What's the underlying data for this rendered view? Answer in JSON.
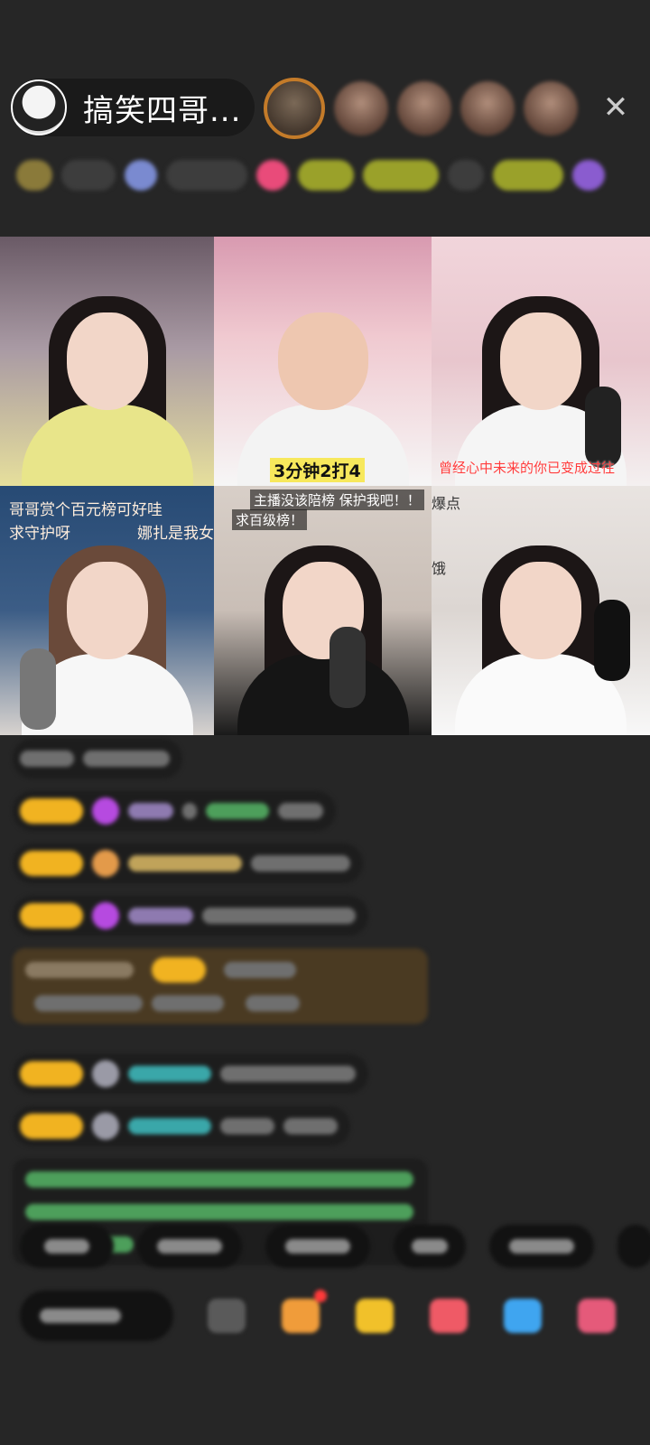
{
  "header": {
    "host_name": "搞笑四哥...",
    "close_glyph": "✕"
  },
  "video_grid": {
    "tile2_score": "3分钟2打4",
    "tile3_caption": "曾经心中未来的你已变成过往",
    "tile4_line1": "哥哥赏个百元榜可好哇",
    "tile4_line2": "求守护呀",
    "tile4_line3": "娜扎是我女",
    "tile5_line1": "主播没该陪榜 保护我吧！！",
    "tile5_line2": "求百级榜！",
    "tile6_line1": "爆点",
    "tile6_line2": "饿"
  },
  "colors": {
    "background": "#262626",
    "badge": "#f1b321",
    "score_bg": "#f7e85c",
    "caption_red": "#ff3b3b"
  },
  "icons": {
    "close": "close-icon",
    "emoji": "emoji-icon",
    "gift": "gift-icon",
    "fan": "star-icon",
    "game": "game-icon",
    "share": "share-icon",
    "more": "more-icon"
  }
}
